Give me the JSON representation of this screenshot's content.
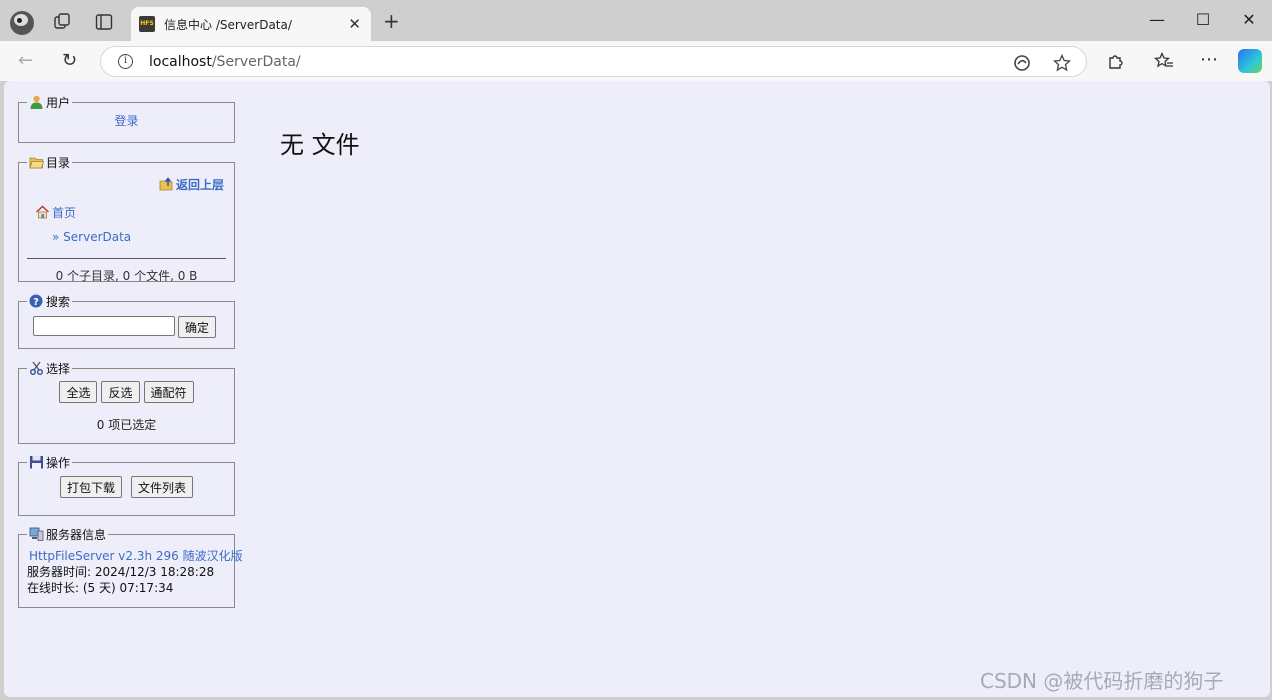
{
  "browser": {
    "tab_title": "信息中心 /ServerData/",
    "tab_favicon_text": "HFS",
    "tab_close": "✕",
    "new_tab": "+",
    "url_host": "localhost",
    "url_path": "/ServerData/",
    "window": {
      "minimize": "—",
      "maximize": "☐",
      "close": "✕"
    },
    "nav": {
      "back": "←",
      "reload": "↻",
      "more": "⋯",
      "info": "i"
    }
  },
  "sidebar": {
    "user": {
      "legend": "用户",
      "login": "登录",
      "icon": "user-icon"
    },
    "folder": {
      "legend": "目录",
      "up_link": "返回上层",
      "home": "首页",
      "current": "» ServerData",
      "summary": "0 个子目录, 0 个文件, 0 B"
    },
    "search": {
      "legend": "搜索",
      "input_value": "",
      "submit": "确定"
    },
    "select": {
      "legend": "选择",
      "select_all": "全选",
      "invert": "反选",
      "mask": "通配符",
      "count": "0 项已选定"
    },
    "actions": {
      "legend": "操作",
      "archive": "打包下载",
      "file_list": "文件列表"
    },
    "server": {
      "legend": "服务器信息",
      "software": "HttpFileServer v2.3h 296 随波汉化版",
      "time": "服务器时间: 2024/12/3 18:28:28",
      "uptime": "在线时长: (5 天) 07:17:34"
    }
  },
  "main": {
    "title": "无 文件"
  },
  "watermark": "CSDN @被代码折磨的狗子",
  "colors": {
    "page_bg": "#eeeefa",
    "link": "#3c6cc7",
    "chrome": "#cfcfcf"
  }
}
